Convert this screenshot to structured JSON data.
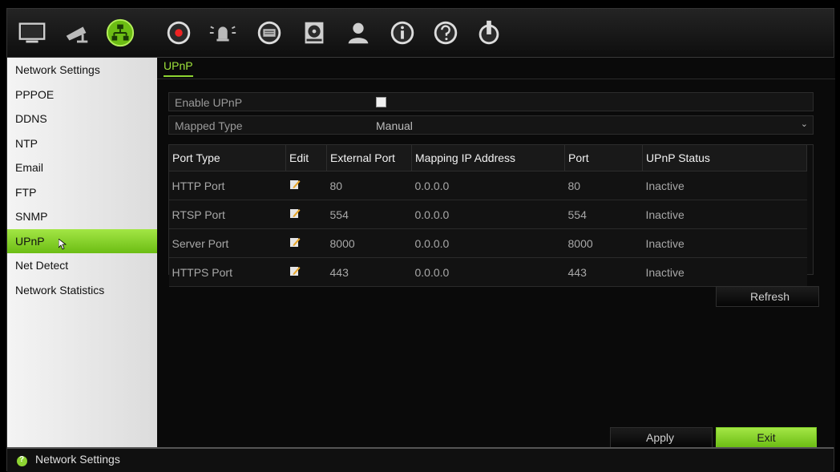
{
  "toolbar": {
    "icons": [
      "display-icon",
      "camera-icon",
      "network-icon",
      "record-icon",
      "alarm-icon",
      "device-icon",
      "storage-icon",
      "user-icon",
      "info-icon",
      "help-icon",
      "power-icon"
    ],
    "active": "network-icon"
  },
  "sidebar": {
    "items": [
      {
        "label": "Network Settings"
      },
      {
        "label": "PPPOE"
      },
      {
        "label": "DDNS"
      },
      {
        "label": "NTP"
      },
      {
        "label": "Email"
      },
      {
        "label": "FTP"
      },
      {
        "label": "SNMP"
      },
      {
        "label": "UPnP",
        "active": true
      },
      {
        "label": "Net Detect"
      },
      {
        "label": "Network Statistics"
      }
    ]
  },
  "main": {
    "tab": "UPnP",
    "enable_upnp": {
      "label": "Enable UPnP",
      "checked": true
    },
    "mapped_type": {
      "label": "Mapped Type",
      "value": "Manual"
    },
    "table": {
      "headers": [
        "Port Type",
        "Edit",
        "External Port",
        "Mapping IP Address",
        "Port",
        "UPnP Status"
      ],
      "rows": [
        {
          "port_type": "HTTP Port",
          "external_port": "80",
          "mapping_ip": "0.0.0.0",
          "port": "80",
          "status": "Inactive"
        },
        {
          "port_type": "RTSP Port",
          "external_port": "554",
          "mapping_ip": "0.0.0.0",
          "port": "554",
          "status": "Inactive"
        },
        {
          "port_type": "Server Port",
          "external_port": "8000",
          "mapping_ip": "0.0.0.0",
          "port": "8000",
          "status": "Inactive"
        },
        {
          "port_type": "HTTPS Port",
          "external_port": "443",
          "mapping_ip": "0.0.0.0",
          "port": "443",
          "status": "Inactive"
        }
      ]
    },
    "refresh_label": "Refresh",
    "apply_label": "Apply",
    "exit_label": "Exit"
  },
  "statusbar": {
    "text": "Network Settings"
  },
  "colors": {
    "accent": "#8ed432",
    "background": "#0a0a0a",
    "sidebar": "#e8e8e8"
  }
}
